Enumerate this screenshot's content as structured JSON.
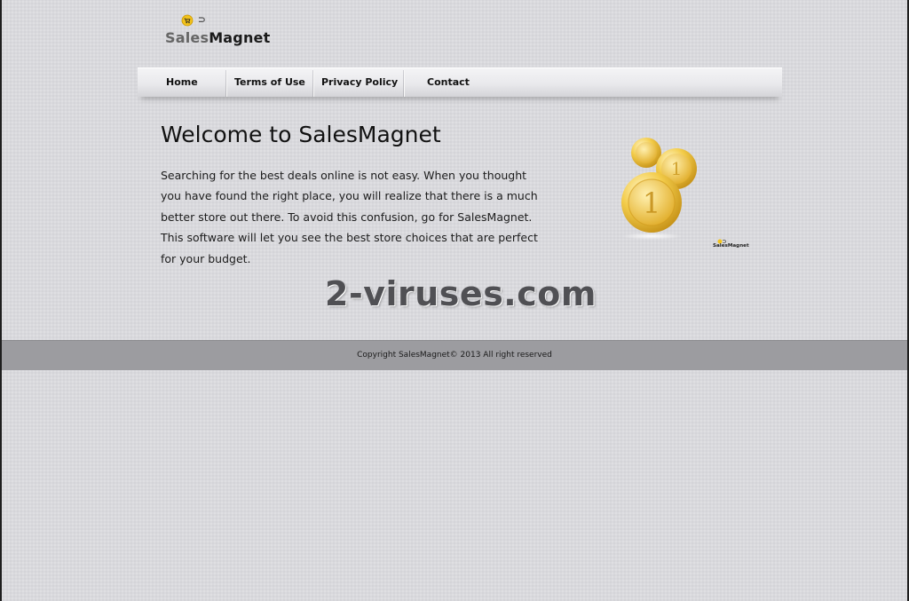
{
  "brand": {
    "logo_sales": "Sales",
    "logo_magnet": "Magnet",
    "small_logo_text": "SalesMagnet"
  },
  "nav": {
    "items": [
      {
        "label": "Home"
      },
      {
        "label": "Terms of Use"
      },
      {
        "label": "Privacy Policy"
      },
      {
        "label": "Contact"
      }
    ]
  },
  "main": {
    "title": "Welcome to SalesMagnet",
    "intro": "Searching for the best deals online is not easy. When you thought you have found the right place, you will realize that there is a much better store out there. To avoid this confusion, go for SalesMagnet. This software will let you see the best store choices that are perfect for your budget."
  },
  "watermark": "2-viruses.com",
  "footer": {
    "copyright": "Copyright SalesMagnet© 2013 All right reserved"
  },
  "icons": {
    "logo": "shopping-cart-magnet-icon",
    "illustration": "gold-coins-image"
  },
  "colors": {
    "background": "#d9d9dd",
    "footer": "#9c9ca0",
    "coin_gold": "#e8b923"
  }
}
